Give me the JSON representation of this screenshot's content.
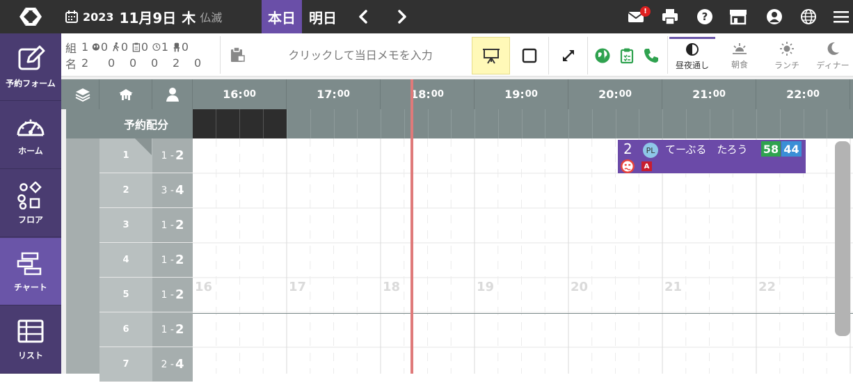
{
  "header": {
    "year": "2023",
    "month_day": "11月9日",
    "weekday": "木",
    "rokuyo": "仏滅",
    "today_label": "本日",
    "tomorrow_label": "明日",
    "mail_badge": "!"
  },
  "sidebar": {
    "items": [
      {
        "label": "予約フォーム",
        "icon": "edit-icon"
      },
      {
        "label": "ホーム",
        "icon": "gauge-icon"
      },
      {
        "label": "フロア",
        "icon": "floor-shapes-icon"
      },
      {
        "label": "チャート",
        "icon": "chart-icon"
      },
      {
        "label": "リスト",
        "icon": "table-icon"
      }
    ]
  },
  "stats": {
    "row1": [
      "組",
      "1",
      "0",
      "0",
      "0",
      "1",
      "0"
    ],
    "row2": [
      "名",
      "2",
      "0",
      "0",
      "0",
      "2",
      "0"
    ]
  },
  "memo": {
    "placeholder": "クリックして当日メモを入力"
  },
  "meals": [
    {
      "label": "昼夜通し",
      "icon": "half-circle-icon"
    },
    {
      "label": "朝食",
      "icon": "sunrise-icon"
    },
    {
      "label": "ランチ",
      "icon": "sun-icon"
    },
    {
      "label": "ディナー",
      "icon": "moon-icon"
    }
  ],
  "chart": {
    "allocation_label": "予約配分",
    "hours": [
      {
        "h": "16:",
        "m": "00"
      },
      {
        "h": "17:",
        "m": "00"
      },
      {
        "h": "18:",
        "m": "00"
      },
      {
        "h": "19:",
        "m": "00"
      },
      {
        "h": "20:",
        "m": "00"
      },
      {
        "h": "21:",
        "m": "00"
      },
      {
        "h": "22:",
        "m": "00"
      }
    ],
    "ghost_hours": [
      "16",
      "17",
      "18",
      "19",
      "20",
      "21",
      "22"
    ],
    "tables": [
      {
        "no": "1",
        "min": "1 -",
        "max": "2"
      },
      {
        "no": "2",
        "min": "3 -",
        "max": "4"
      },
      {
        "no": "3",
        "min": "1 -",
        "max": "2"
      },
      {
        "no": "4",
        "min": "1 -",
        "max": "2"
      },
      {
        "no": "5",
        "min": "1 -",
        "max": "2"
      },
      {
        "no": "6",
        "min": "1 -",
        "max": "2"
      },
      {
        "no": "7",
        "min": "2 -",
        "max": "4"
      }
    ]
  },
  "booking": {
    "party_size": "2",
    "badge": "PL",
    "name": "てーぶる　たろう",
    "num1": "58",
    "num2": "44",
    "tag": "A"
  },
  "colors": {
    "accent": "#6a4fa8",
    "header": "#7d8b8b",
    "now_line": "#df7a7a"
  }
}
